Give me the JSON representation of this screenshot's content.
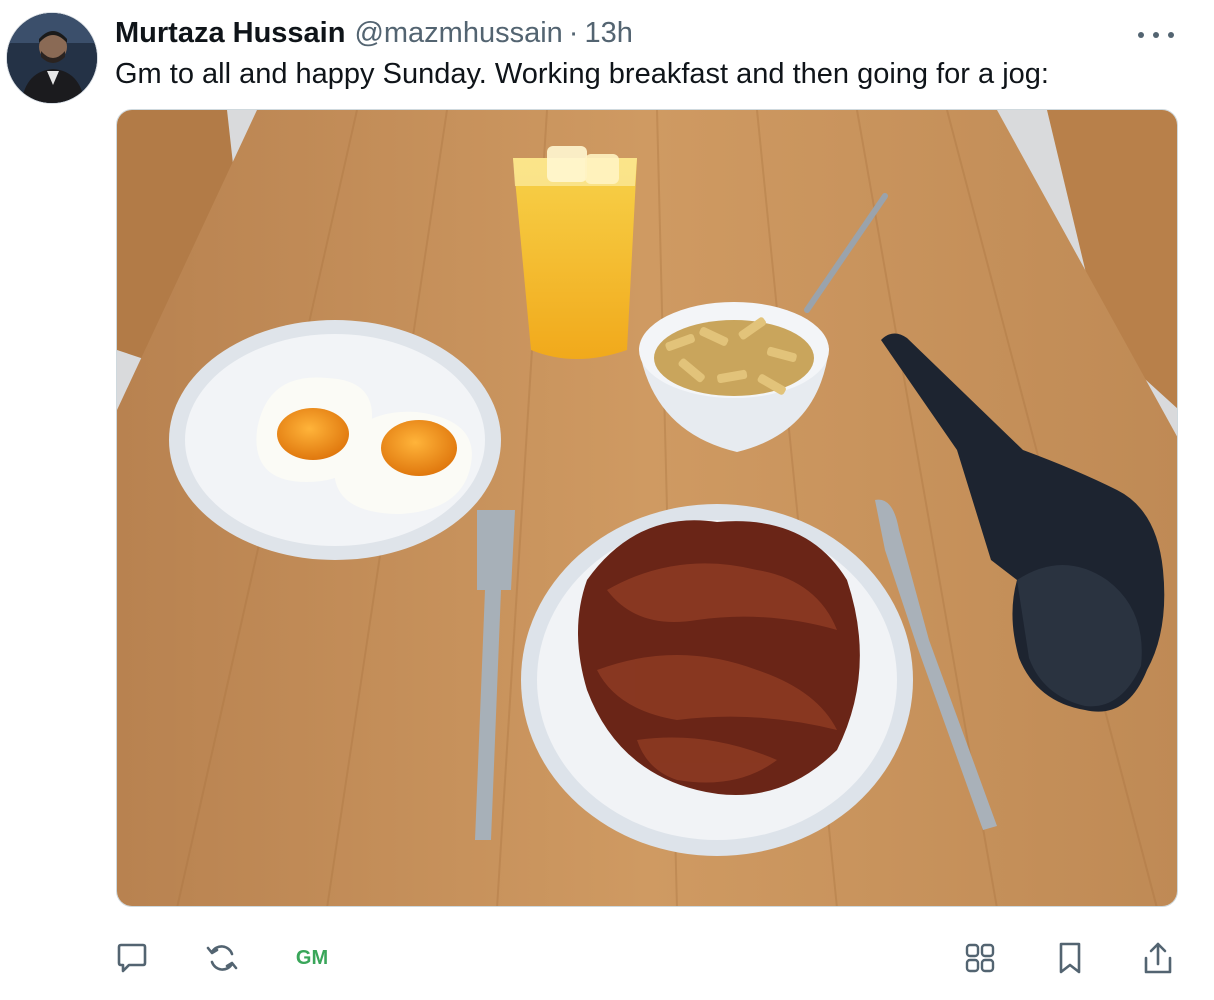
{
  "tweet": {
    "author_name": "Murtaza Hussain",
    "handle": "@mazmhussain",
    "separator": "·",
    "time": "13h",
    "text": "Gm to all and happy Sunday. Working breakfast and then going for a jog:"
  },
  "actions": {
    "reply_icon": "reply-icon",
    "retweet_icon": "retweet-icon",
    "gm_label": "GM",
    "gallery_icon": "grid-icon",
    "bookmark_icon": "bookmark-icon",
    "share_icon": "share-icon"
  },
  "colors": {
    "icon_gray": "#536471",
    "gm_green": "#3aa65a",
    "table_wood": "#c9935a"
  }
}
